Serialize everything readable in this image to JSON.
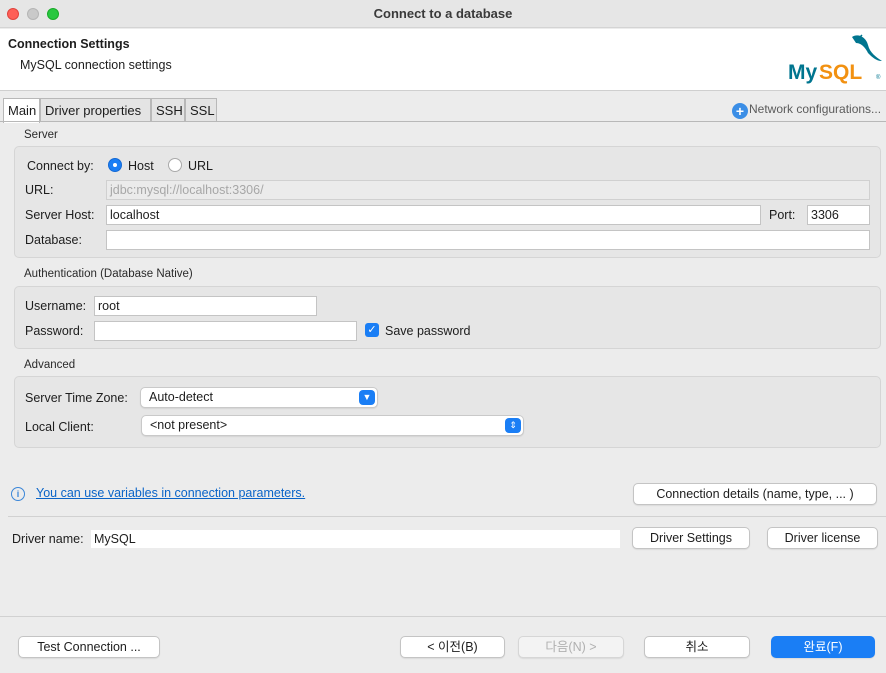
{
  "window": {
    "title": "Connect to a database"
  },
  "header": {
    "title": "Connection Settings",
    "subtitle": "MySQL connection settings",
    "logo_text": "MySQL"
  },
  "tabs": [
    {
      "label": "Main",
      "active": true
    },
    {
      "label": "Driver properties",
      "active": false
    },
    {
      "label": "SSH",
      "active": false
    },
    {
      "label": "SSL",
      "active": false
    }
  ],
  "network_config": {
    "label": "Network configurations..."
  },
  "server": {
    "group_label": "Server",
    "connect_by_label": "Connect by:",
    "connect_by_options": [
      "Host",
      "URL"
    ],
    "connect_by_selected": "Host",
    "url_label": "URL:",
    "url_value": "jdbc:mysql://localhost:3306/",
    "host_label": "Server Host:",
    "host_value": "localhost",
    "port_label": "Port:",
    "port_value": "3306",
    "database_label": "Database:",
    "database_value": ""
  },
  "auth": {
    "group_label": "Authentication (Database Native)",
    "username_label": "Username:",
    "username_value": "root",
    "password_label": "Password:",
    "password_value": "",
    "save_password_label": "Save password",
    "save_password_checked": true
  },
  "advanced": {
    "group_label": "Advanced",
    "timezone_label": "Server Time Zone:",
    "timezone_value": "Auto-detect",
    "local_client_label": "Local Client:",
    "local_client_value": "<not present>"
  },
  "info_link": "You can use variables in connection parameters.",
  "connection_details_button": "Connection details (name, type, ... )",
  "driver": {
    "label": "Driver name:",
    "value": "MySQL",
    "settings_button": "Driver Settings",
    "license_button": "Driver license"
  },
  "footer": {
    "test_button": "Test Connection ...",
    "back_button": "< 이전(B)",
    "next_button": "다음(N) >",
    "cancel_button": "취소",
    "finish_button": "완료(F)"
  },
  "colors": {
    "accent": "#1a7ef5",
    "link": "#0a64c8",
    "mysql_blue": "#00758f",
    "mysql_orange": "#f29111"
  }
}
